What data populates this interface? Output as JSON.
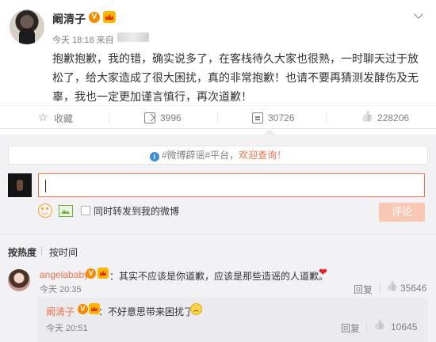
{
  "post": {
    "username": "阚清子",
    "time": "今天 18:18 来自",
    "content": "抱歉抱歉，我的错，确实说多了，在客栈待久大家也很熟，一时聊天过于放松了，给大家造成了很大困扰，真的非常抱歉！也请不要再猜测发酵伤及无辜，我也一定更加谨言慎行，再次道歉！",
    "verified_badge": "V"
  },
  "actions": {
    "favorite": "收藏",
    "repost_count": "3996",
    "comment_count": "30726",
    "like_count": "228206"
  },
  "rumor_bar": {
    "prefix": "#微博辟谣#平台，",
    "link": "欢迎查询！"
  },
  "composer": {
    "checkbox_label": "同时转发到我的微博",
    "submit_label": "评论"
  },
  "sort": {
    "hot": "按热度",
    "time": "按时间"
  },
  "comment": {
    "username": "angelababy",
    "text": "：其实不应该是你道歉，应该是那些造谣的人道歉。",
    "time": "今天 20:35",
    "reply_label": "回复",
    "likes": "35646"
  },
  "reply": {
    "username": "阚清子",
    "text": "：不好意思带来困扰了",
    "time": "今天 20:51",
    "reply_label": "回复",
    "likes": "10645"
  },
  "colors": {
    "accent": "#eb7350",
    "link_blue": "#3d8fd6",
    "text": "#333333",
    "muted": "#808080"
  }
}
